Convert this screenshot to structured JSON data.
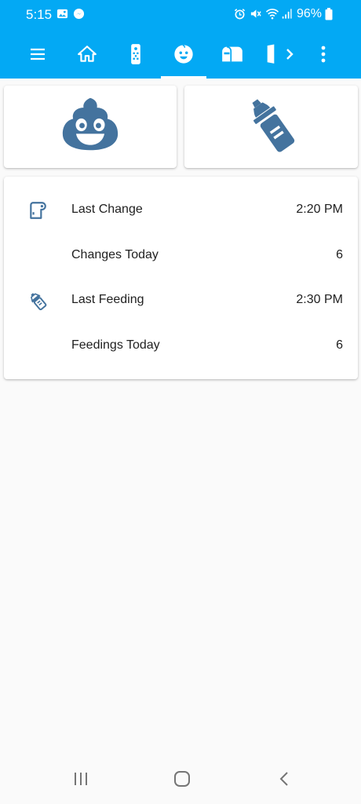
{
  "status_bar": {
    "time": "5:15",
    "battery": "96%",
    "left_icons": [
      "image-icon",
      "messenger-icon"
    ],
    "right_icons": [
      "alarm-icon",
      "mute-icon",
      "wifi-icon",
      "signal-icon",
      "battery-icon"
    ]
  },
  "toolbar": {
    "tabs": [
      {
        "icon": "menu-icon"
      },
      {
        "icon": "home-icon"
      },
      {
        "icon": "remote-icon"
      },
      {
        "icon": "baby-face-icon",
        "active": true
      },
      {
        "icon": "mailbox-icon"
      },
      {
        "icon": "door-icon"
      },
      {
        "icon": "chevron-right-icon"
      },
      {
        "icon": "more-vert-icon"
      }
    ]
  },
  "action_buttons": [
    {
      "icon": "emoticon-poop-icon"
    },
    {
      "icon": "baby-bottle-icon"
    }
  ],
  "entities": [
    {
      "icon": "toilet-paper-icon",
      "label": "Last Change",
      "value": "2:20 PM"
    },
    {
      "icon": "",
      "label": "Changes Today",
      "value": "6"
    },
    {
      "icon": "baby-bottle-outline-icon",
      "label": "Last Feeding",
      "value": "2:30 PM"
    },
    {
      "icon": "",
      "label": "Feedings Today",
      "value": "6"
    }
  ],
  "colors": {
    "primary": "#03a9f4",
    "icon": "#44739e",
    "text": "#212121",
    "background": "#fafafa"
  },
  "nav_bar": [
    "recents-icon",
    "home-button-icon",
    "back-icon"
  ]
}
